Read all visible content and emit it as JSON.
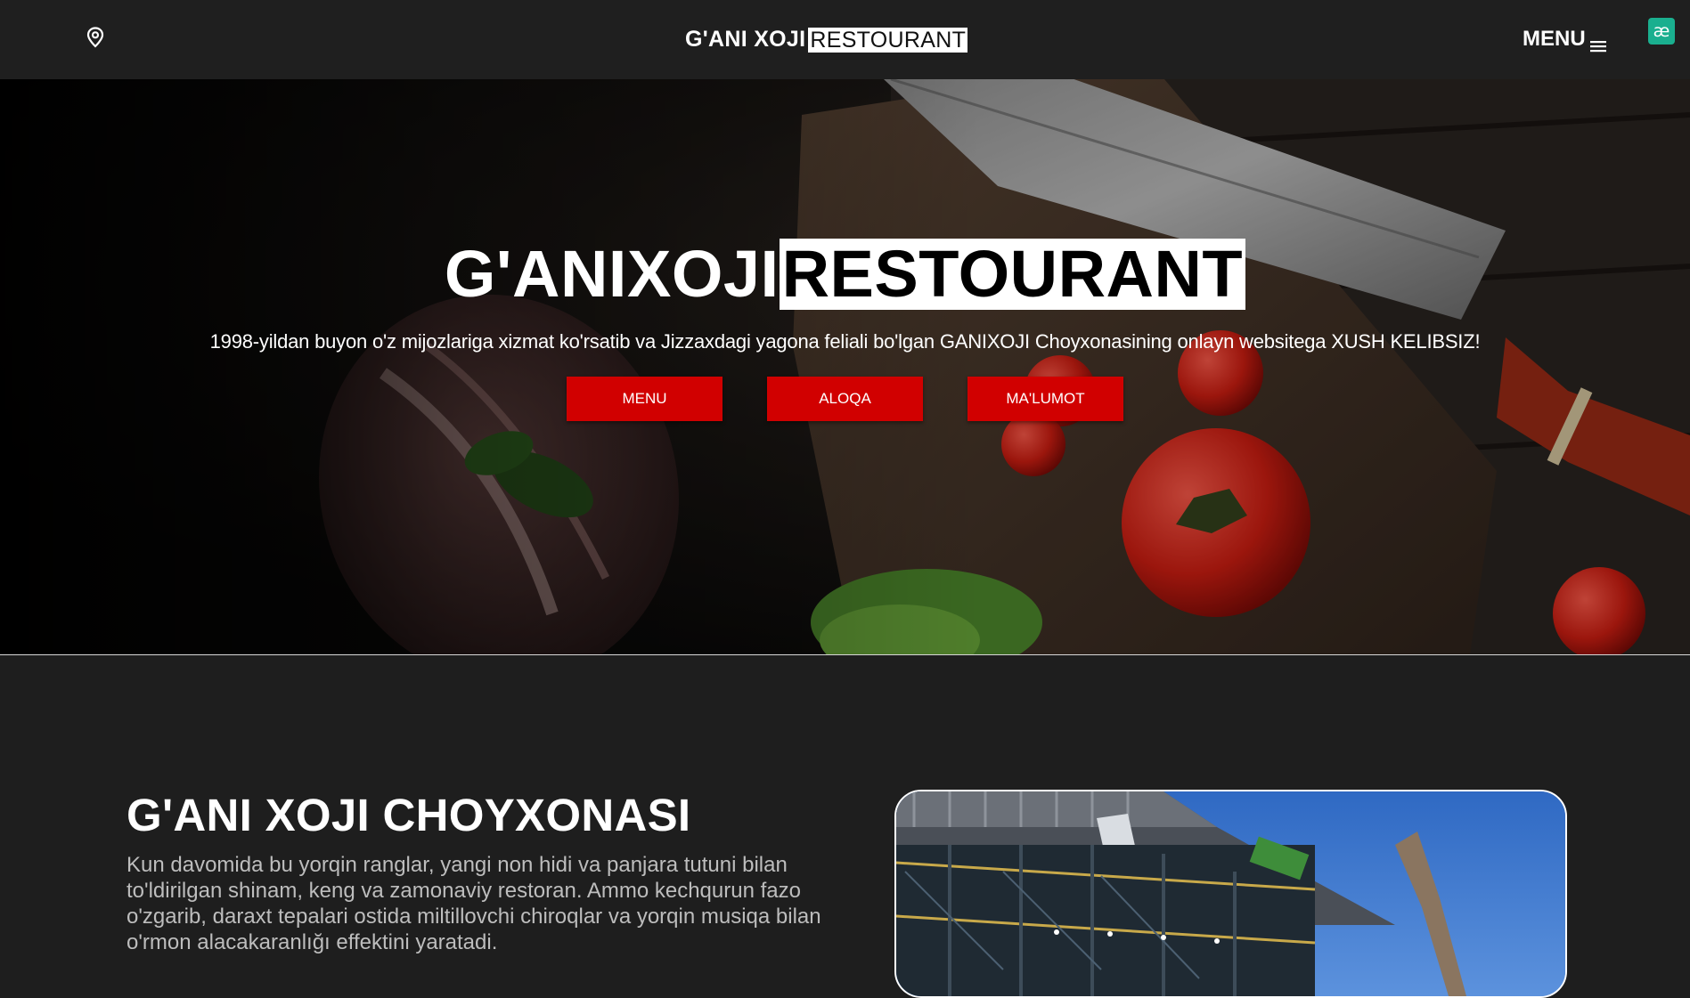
{
  "header": {
    "location_icon": "map-pin-icon",
    "brand_main": "G'ANI XOJI",
    "brand_highlight": "RESTOURANT",
    "menu_label": "MENU",
    "menu_icon": "hamburger-icon",
    "extension_badge": "æ"
  },
  "hero": {
    "title_main": "G'ANIXOJI",
    "title_highlight": "RESTOURANT",
    "subtitle": "1998-yildan buyon o'z mijozlariga xizmat ko'rsatib va Jizzaxdagi yagona feliali bo'lgan GANIXOJI Choyxonasining onlayn websitega XUSH KELIBSIZ!",
    "buttons": [
      {
        "label": "MENU"
      },
      {
        "label": "ALOQA"
      },
      {
        "label": "MA'LUMOT"
      }
    ],
    "accent_color": "#d10000"
  },
  "about": {
    "title": "G'ANI XOJI CHOYXONASI",
    "text": "Kun davomida bu yorqin ranglar, yangi non hidi va panjara tutuni bilan to'ldirilgan shinam, keng va zamonaviy restoran. Ammo kechqurun fazo o'zgarib, daraxt tepalari ostida miltillovchi chiroqlar va yorqin musiqa bilan o'rmon alacakaranlığı effektini yaratadi."
  }
}
